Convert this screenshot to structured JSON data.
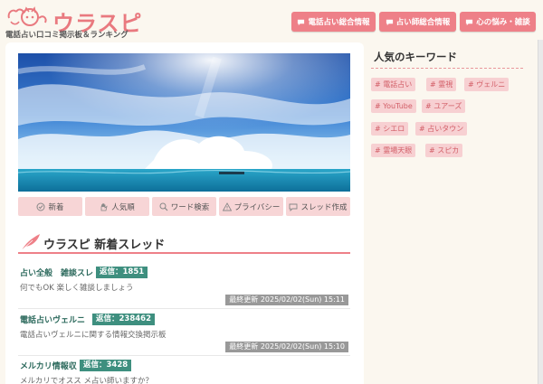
{
  "header": {
    "logo_title": "ウラスピ",
    "logo_subtitle": "電話占い口コミ掲示板＆ランキング",
    "nav": [
      {
        "label": "電話占い総合情報"
      },
      {
        "label": "占い師総合情報"
      },
      {
        "label": "心の悩み・雑談"
      }
    ]
  },
  "tabs": [
    {
      "label": "新着",
      "icon": "check-circle-icon"
    },
    {
      "label": "人気順",
      "icon": "hand-icon"
    },
    {
      "label": "ワード検索",
      "icon": "search-icon"
    },
    {
      "label": "プライバシー",
      "icon": "warning-icon"
    },
    {
      "label": "スレッド作成",
      "icon": "chat-bubble-icon"
    }
  ],
  "section": {
    "title": "ウラスピ 新着スレッド"
  },
  "threads": [
    {
      "title": "占い全般　雑談スレ",
      "badge": "返信：1851",
      "description": "何でもOK 楽しく雑談しましょう",
      "updated": "最終更新  2025/02/02(Sun) 15:11"
    },
    {
      "title": "電話占いヴェルニ",
      "badge": "返信：238462",
      "description": "電話占いヴェルニに関する情報交換掲示板",
      "updated": "最終更新  2025/02/02(Sun) 15:10"
    },
    {
      "title": "メルカリ情報収",
      "badge": "返信：3428",
      "description": "メルカリでオスス メ占い師いますか？",
      "updated": ""
    }
  ],
  "sidebar": {
    "title": "人気のキーワード",
    "keywords": [
      "# 電話占い",
      "# 霊視",
      "# ヴェルニ",
      "# YouTube",
      "# ユアーズ",
      "# シエロ",
      "# 占いタウン",
      "# 霊場天眼",
      "# スピカ"
    ]
  },
  "colors": {
    "accent": "#ee8088",
    "thread_title": "#2e6b5e",
    "badge": "#3e8f7f",
    "keyword_bg": "#f7d0d2"
  }
}
